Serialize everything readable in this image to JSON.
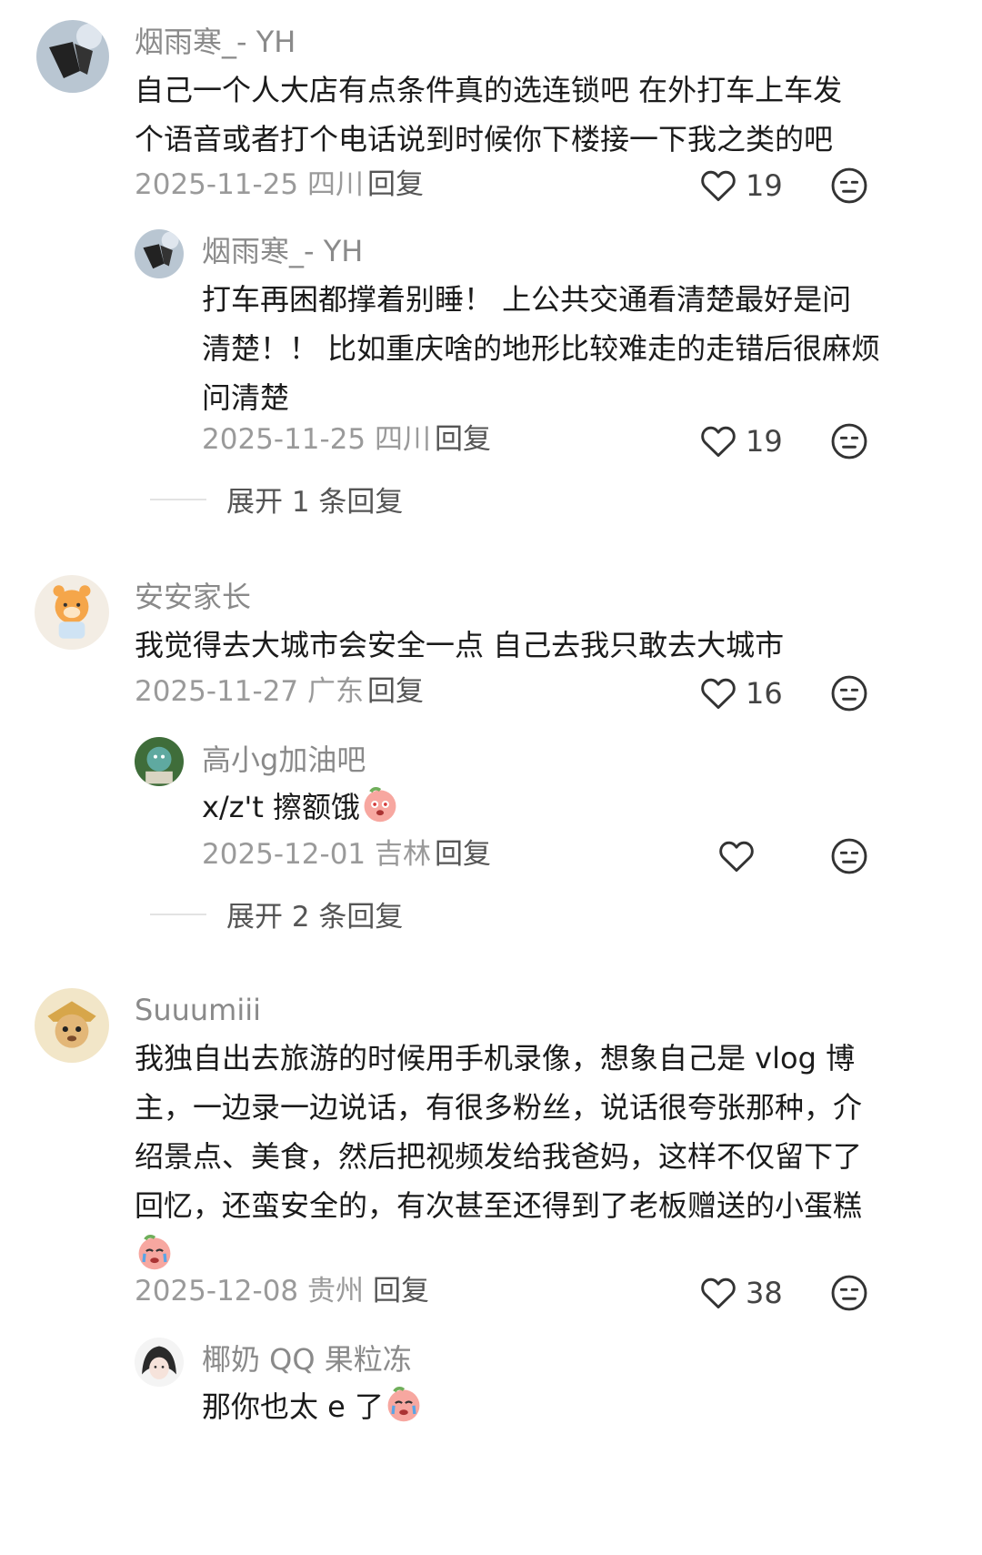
{
  "comments": [
    {
      "username": "烟雨寒_- YH",
      "lines": [
        "自己一个人大店有点条件真的选连锁吧 在外打车上车发",
        "个语音或者打个电话说到时候你下楼接一下我之类的吧"
      ],
      "meta": "2025-11-25 四川",
      "reply": "回复",
      "likes": "19",
      "replies": [
        {
          "username": "烟雨寒_- YH",
          "lines": [
            "打车再困都撑着别睡！ 上公共交通看清楚最好是问",
            "清楚！！ 比如重庆啥的地形比较难走的走错后很麻烦",
            "问清楚"
          ],
          "meta": "2025-11-25 四川",
          "reply": "回复",
          "likes": "19"
        }
      ],
      "expand": "展开 1 条回复"
    },
    {
      "username": "安安家长",
      "lines": [
        "我觉得去大城市会安全一点 自己去我只敢去大城市"
      ],
      "meta": "2025-11-27 广东",
      "reply": "回复",
      "likes": "16",
      "replies": [
        {
          "username": "高小g加油吧",
          "lines": [
            "x/z't 擦额饿"
          ],
          "meta": "2025-12-01 吉林",
          "reply": "回复",
          "likes": ""
        }
      ],
      "expand": "展开 2 条回复"
    },
    {
      "username": "Suuumiii",
      "lines": [
        "我独自出去旅游的时候用手机录像，想象自己是 vlog 博",
        "主，一边录一边说话，有很多粉丝，说话很夸张那种，介",
        "绍景点、美食，然后把视频发给我爸妈，这样不仅留下了",
        "回忆，还蛮安全的，有次甚至还得到了老板赠送的小蛋糕"
      ],
      "meta": "2025-12-08 贵州",
      "reply": "回复",
      "likes": "38",
      "replies": [
        {
          "username": "椰奶 QQ 果粒冻",
          "lines": [
            "那你也太 e 了"
          ],
          "meta": "",
          "reply": "",
          "likes": ""
        }
      ]
    }
  ],
  "icons": {
    "like": "heart-outline-icon",
    "dislike": "neutral-face-icon",
    "emoji": "peach-face-emoji"
  },
  "colors": {
    "text": "#1b1b1b",
    "username": "#8a8a8a",
    "meta": "#9a9a9a"
  }
}
